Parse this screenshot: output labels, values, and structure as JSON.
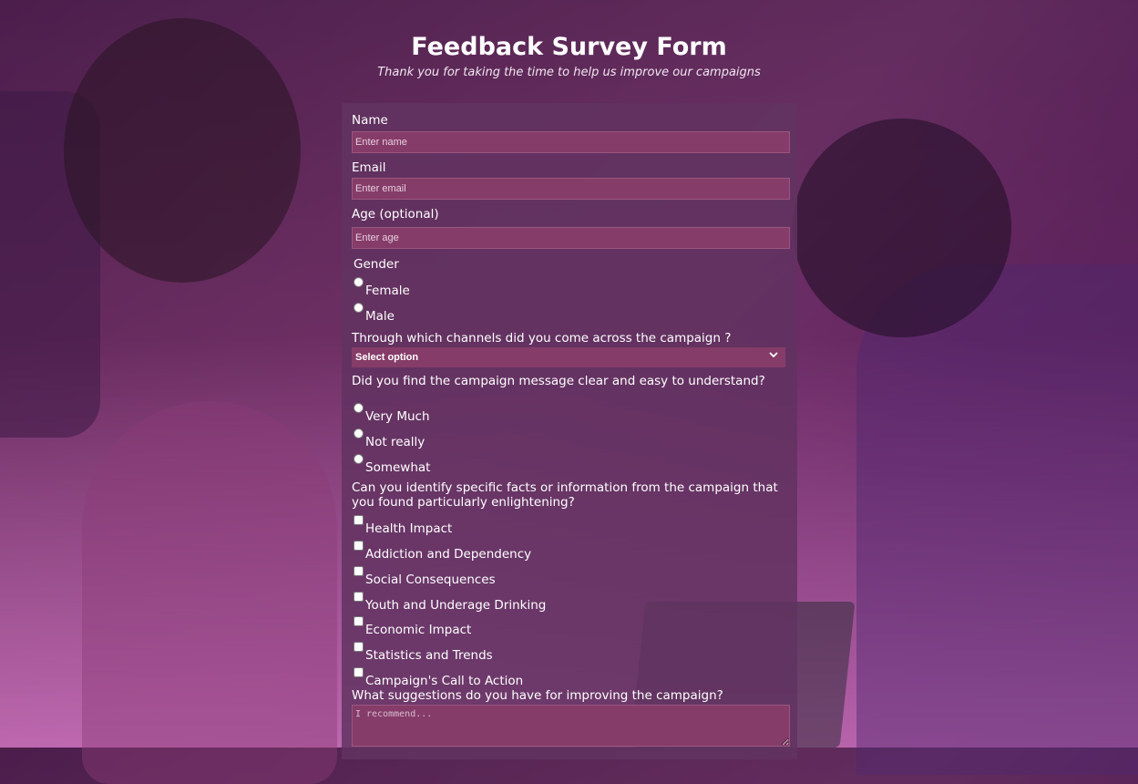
{
  "header": {
    "title": "Feedback Survey Form",
    "subtitle": "Thank you for taking the time to help us improve our campaigns"
  },
  "form": {
    "name": {
      "label": "Name",
      "placeholder": "Enter name",
      "value": ""
    },
    "email": {
      "label": "Email",
      "placeholder": "Enter email",
      "value": ""
    },
    "age": {
      "label": "Age (optional)",
      "placeholder": "Enter age",
      "value": ""
    },
    "gender": {
      "label": "Gender",
      "options": [
        "Female",
        "Male"
      ]
    },
    "channels": {
      "label": "Through which channels did you come across the campaign ?",
      "selected": "Select option"
    },
    "clarity": {
      "label": "Did you find the campaign message clear and easy to understand?",
      "options": [
        "Very Much",
        "Not really",
        "Somewhat"
      ]
    },
    "facts": {
      "label": "Can you identify specific facts or information from the campaign that you found particularly enlightening?",
      "options": [
        "Health Impact",
        "Addiction and Dependency",
        "Social Consequences",
        "Youth and Underage Drinking",
        "Economic Impact",
        "Statistics and Trends",
        "Campaign's Call to Action"
      ]
    },
    "suggestions": {
      "label": "What suggestions do you have for improving the campaign?",
      "placeholder": "I recommend..."
    }
  },
  "icons": {
    "dropdown": "chevron-down-icon"
  }
}
